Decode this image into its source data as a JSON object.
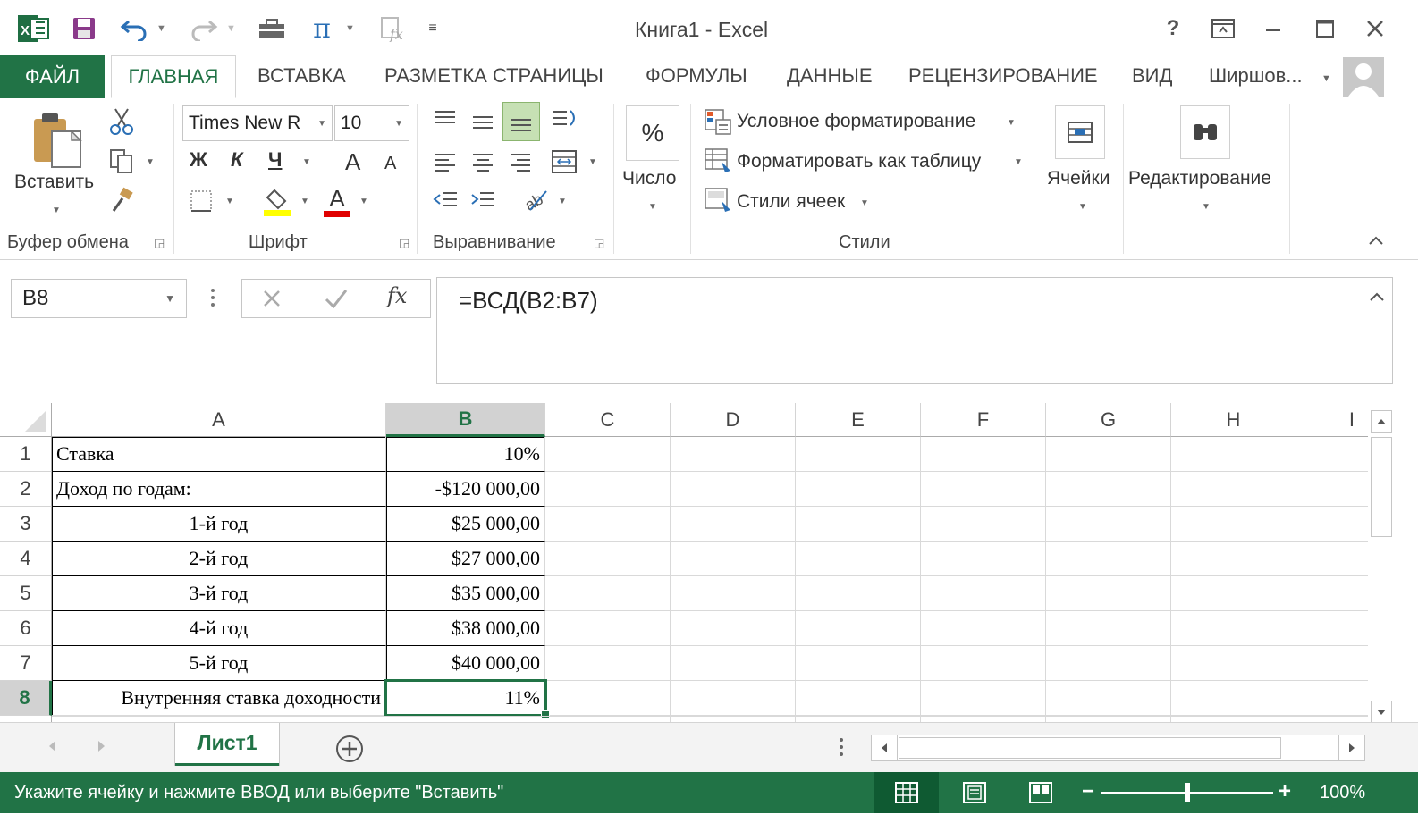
{
  "window": {
    "title": "Книга1 - Excel",
    "help": "?",
    "accent": "#217346"
  },
  "tabs": [
    {
      "label": "ФАЙЛ"
    },
    {
      "label": "ГЛАВНАЯ"
    },
    {
      "label": "ВСТАВКА"
    },
    {
      "label": "РАЗМЕТКА СТРАНИЦЫ"
    },
    {
      "label": "ФОРМУЛЫ"
    },
    {
      "label": "ДАННЫЕ"
    },
    {
      "label": "РЕЦЕНЗИРОВАНИЕ"
    },
    {
      "label": "ВИД"
    }
  ],
  "user": {
    "name": "Ширшов..."
  },
  "ribbon": {
    "clipboard": {
      "paste_label": "Вставить",
      "group_label": "Буфер обмена"
    },
    "font": {
      "font_name": "Times New R",
      "font_size": "10",
      "bold": "Ж",
      "italic": "К",
      "underline": "Ч",
      "grow": "A",
      "shrink": "A",
      "color_letter": "A",
      "group_label": "Шрифт"
    },
    "alignment": {
      "group_label": "Выравнивание"
    },
    "number": {
      "symbol": "%",
      "label": "Число"
    },
    "styles": {
      "conditional": "Условное форматирование",
      "as_table": "Форматировать как таблицу",
      "cell_styles": "Стили ячеек",
      "group_label": "Стили"
    },
    "cells": {
      "label": "Ячейки"
    },
    "editing": {
      "label": "Редактирование"
    }
  },
  "formula_bar": {
    "name_box": "B8",
    "formula": "=ВСД(B2:B7)",
    "fx": "fx"
  },
  "sheet": {
    "columns": [
      "A",
      "B",
      "C",
      "D",
      "E",
      "F",
      "G",
      "H",
      "I"
    ],
    "selected_column": "B",
    "selected_row": "8",
    "rows": [
      {
        "n": "1",
        "a": "Ставка",
        "b": "10%"
      },
      {
        "n": "2",
        "a": "Доход по годам:",
        "b": "-$120 000,00"
      },
      {
        "n": "3",
        "a": "1-й год",
        "b": "$25 000,00"
      },
      {
        "n": "4",
        "a": "2-й год",
        "b": "$27 000,00"
      },
      {
        "n": "5",
        "a": "3-й год",
        "b": "$35 000,00"
      },
      {
        "n": "6",
        "a": "4-й год",
        "b": "$38 000,00"
      },
      {
        "n": "7",
        "a": "5-й год",
        "b": "$40 000,00"
      },
      {
        "n": "8",
        "a": "Внутренняя ставка доходности",
        "b": "11%"
      }
    ]
  },
  "sheet_tabs": [
    {
      "label": "Лист1"
    }
  ],
  "status": {
    "text": "Укажите ячейку и нажмите ВВОД или выберите \"Вставить\"",
    "zoom": "100%",
    "zoom_level_percent": 100
  }
}
